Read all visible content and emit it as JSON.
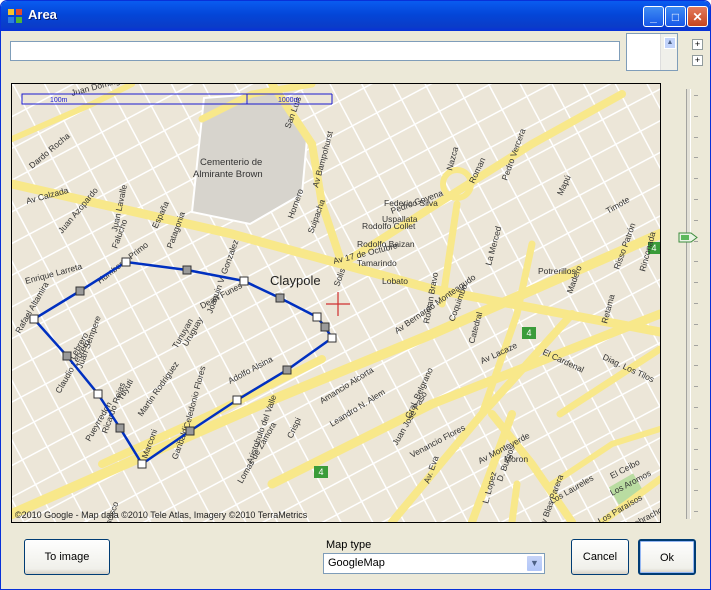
{
  "window": {
    "title": "Area"
  },
  "map": {
    "scale_left": "100m",
    "scale_right": "1000m",
    "attribution": "©2010 Google - Map data ©2010 Tele Atlas, Imagery ©2010 TerraMetrics",
    "place_label": "Claypole",
    "cemetery_label": "Cementerio de Almirante Brown",
    "cemetery_line1": "Cementerio de",
    "cemetery_line2": "Almirante Brown",
    "streets": [
      "Av 17 de Octubre",
      "Av Lacaze",
      "Adolfo Alsina",
      "Av Monteverde",
      "Av Bernardo Monteagudo",
      "Catedral",
      "Roman Bravo",
      "Humberto Primo",
      "Dean Funes",
      "Av Blas Parera",
      "Los Laureles",
      "Diag. Los Tilos",
      "Amancio Alcorta",
      "Leandro N. Alem",
      "Juan Jose Paso",
      "Falucho",
      "España",
      "Patagonia",
      "Dardo Rocha",
      "Juan Azopardo",
      "Juan Lavalle",
      "Uruguay",
      "Ricardo Rojas",
      "Tuyuti",
      "Marconi",
      "Garibaldi",
      "Pedro Goyena",
      "Rodolfo Collet",
      "Rodolfo Baizan",
      "Tamarindo",
      "Federico Silva",
      "Uspallata",
      "Nazca",
      "Roman",
      "Pedro Vercera",
      "Timote",
      "Risso Patrón",
      "Rinconada",
      "Retama",
      "Madero",
      "Mapú",
      "El Cardenal",
      "Venancio Flores",
      "Los Aromos",
      "El Ceibo",
      "Los Paraísos",
      "Los Quebrachos",
      "Moron",
      "D. Burgos",
      "L. Lopez",
      "Crispi",
      "Aristobulo del Valle",
      "Celedonio Flores",
      "Joaquin V. Gonzalez",
      "San Francisco",
      "Solis",
      "Av Bampohurst",
      "Suipacha",
      "Lobato",
      "La Merced",
      "Coquimbo",
      "Pueyrredon",
      "Potrerillos",
      "Hornero",
      "Tunuyan",
      "Gral. Belgrano",
      "Lebrero",
      "Martin Rodriguez",
      "Lomas de Zamora",
      "Claudio Lebrero",
      "San Luis",
      "Av. Eva",
      "Juan Domingo Perón",
      "Av Calzada",
      "Rafael Altamira",
      "Juan Sempere",
      "Enrique Larreta"
    ],
    "route_badges": [
      "4",
      "4",
      "4"
    ]
  },
  "zoom": {
    "level": 0.66
  },
  "buttons": {
    "to_image": "To image",
    "cancel": "Cancel",
    "ok": "Ok"
  },
  "map_type": {
    "label": "Map type",
    "value": "GoogleMap"
  }
}
